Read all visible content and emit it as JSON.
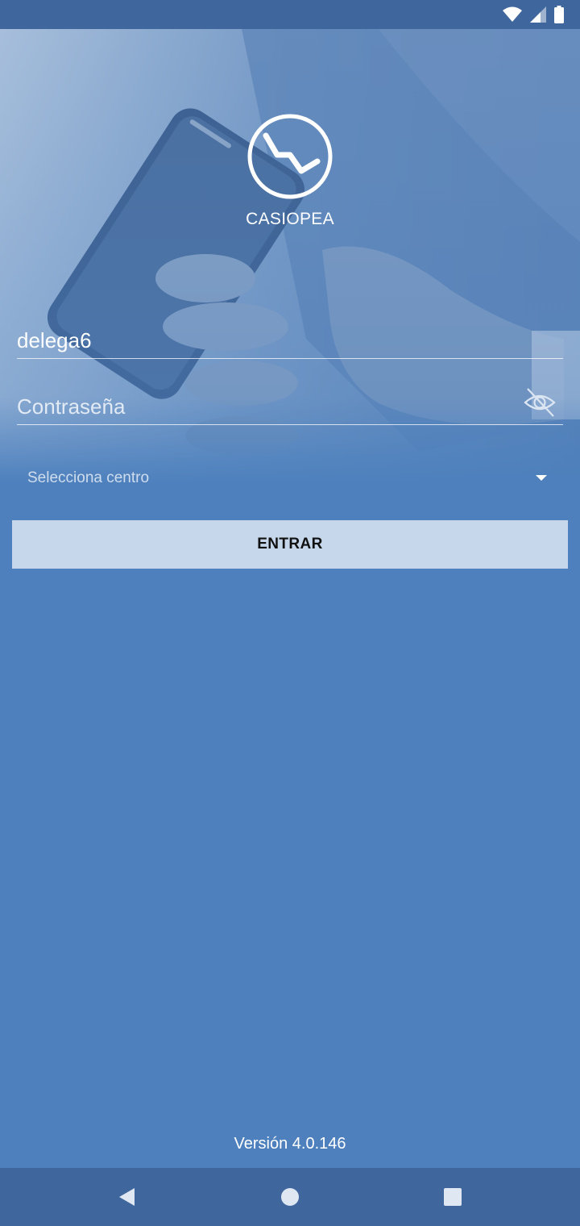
{
  "status_bar": {
    "icons": [
      "wifi-icon",
      "cell-signal-icon",
      "battery-icon"
    ]
  },
  "logo": {
    "icon": "casiopea-logo-icon",
    "app_name": "CASIOPEA"
  },
  "login": {
    "username_value": "delega6",
    "password_placeholder": "Contraseña",
    "password_toggle_icon": "eye-off-icon",
    "center_select_placeholder": "Selecciona centro",
    "enter_label": "ENTRAR"
  },
  "footer": {
    "version": "Versión 4.0.146"
  },
  "nav_bar": {
    "icons": [
      "back-icon",
      "home-icon",
      "recents-icon"
    ]
  },
  "colors": {
    "background": "#4d80bd",
    "system_bars": "#3f679d",
    "button": "#c6d6eb",
    "text": "#ffffff"
  }
}
